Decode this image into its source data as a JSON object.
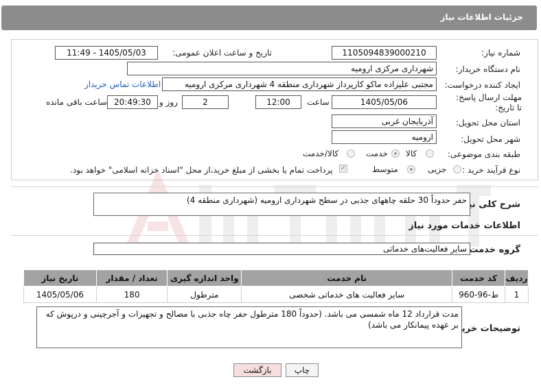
{
  "header": {
    "title": "جزئیات اطلاعات نیاز"
  },
  "form": {
    "need_number_label": "شماره نیاز:",
    "need_number": "1105094839000210",
    "announce_label": "تاریخ و ساعت اعلان عمومی:",
    "announce_value": "1405/05/03 - 11:49",
    "buyer_org_label": "نام دستگاه خریدار:",
    "buyer_org": "شهرداری مرکزی ارومیه",
    "creator_label": "ایجاد کننده درخواست:",
    "creator": "مجتبی علیزاده ماکو کارپرداز شهرداری منطقه 4 شهرداری مرکزی ارومیه",
    "contact_link": "اطلاعات تماس خریدار",
    "deadline_label": "مهلت ارسال پاسخ: تا تاریخ:",
    "deadline_date": "1405/05/06",
    "time_label": "ساعت",
    "deadline_time": "12:00",
    "days_value": "2",
    "days_label": "روز و",
    "remaining_time": "20:49:30",
    "remaining_label": "ساعت باقی مانده",
    "province_label": "استان محل تحویل:",
    "province": "آذربایجان غربی",
    "city_label": "شهر محل تحویل:",
    "city": "ارومیه",
    "category_label": "طبقه بندی موضوعی:",
    "category_options": [
      "کالا",
      "خدمت",
      "کالا/خدمت"
    ],
    "process_label": "نوع فرآیند خرید :",
    "process_options": [
      "جزیی",
      "متوسط"
    ],
    "payment_note": "پرداخت تمام یا بخشی از مبلغ خرید،از محل \"اسناد خزانه اسلامی\" خواهد بود."
  },
  "summary": {
    "label": "شرح کلی نیاز:",
    "value": "حفر حدوداً 30 حلقه چاههای جذبی در سطح شهرداری ارومیه (شهرداری منطقه 4)"
  },
  "services": {
    "section_title": "اطلاعات خدمات مورد نیاز",
    "group_label": "گروه خدمت:",
    "group_value": "سایر فعالیت‌های خدماتی",
    "columns": [
      "ردیف",
      "کد خدمت",
      "نام خدمت",
      "واحد اندازه گیری",
      "تعداد / مقدار",
      "تاریخ نیاز"
    ],
    "rows": [
      [
        "1",
        "ط-96-960",
        "سایر فعالیت های خدماتی شخصی",
        "مترطول",
        "180",
        "1405/05/06"
      ]
    ]
  },
  "buyer_notes": {
    "label": "توضیحات خریدار:",
    "value": "مدت قرارداد 12 ماه شمسی می باشد. (حدوداً 180 مترطول حفر چاه جذبی با مصالح و تجهیزات و آجرچینی و درپوش که بر عهده پیمانکار می باشد)"
  },
  "buttons": {
    "print": "چاپ",
    "back": "بازگشت"
  },
  "colors": {
    "header_bg": "#8c8c8c",
    "table_header_bg": "#a3a3a3",
    "link": "#1f5fbf",
    "back_button_bg": "#f7dede"
  }
}
